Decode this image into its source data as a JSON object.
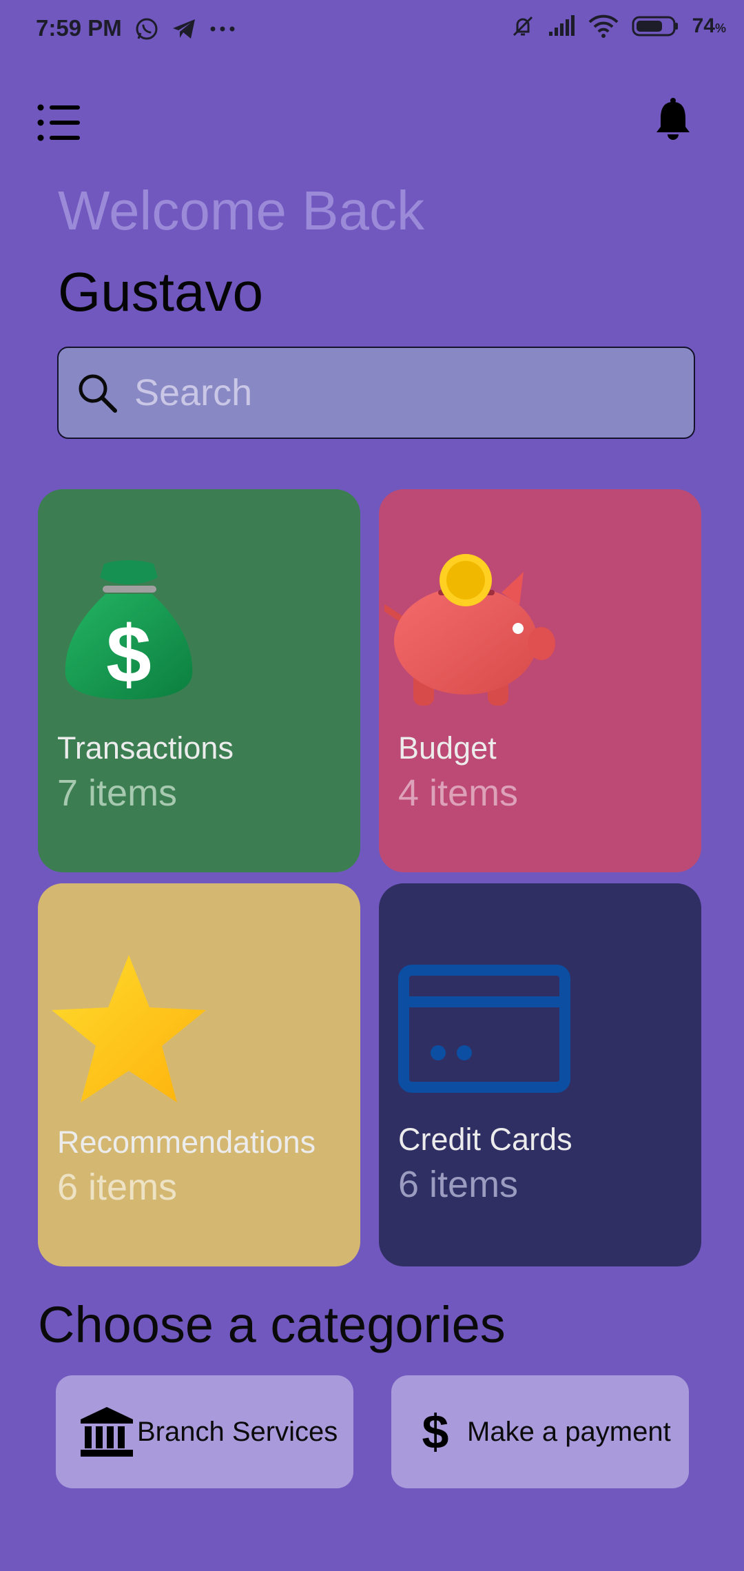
{
  "status_bar": {
    "time": "7:59 PM",
    "left_icons": [
      "whatsapp-icon",
      "telegram-icon",
      "more-dots-icon"
    ],
    "right_icons": [
      "mute-icon",
      "signal-icon",
      "wifi-icon",
      "battery-icon"
    ],
    "battery_percent": "74",
    "battery_unit": "%",
    "battery_level": 0.74
  },
  "header": {
    "menu_icon": "list-menu-icon",
    "notification_icon": "bell-icon"
  },
  "greeting": {
    "welcome": "Welcome Back",
    "user_name": "Gustavo"
  },
  "search": {
    "placeholder": "Search",
    "value": ""
  },
  "cards": [
    {
      "title": "Transactions",
      "count": "7 items",
      "icon": "money-bag-icon",
      "color": "#3C7D52"
    },
    {
      "title": "Budget",
      "count": "4 items",
      "icon": "piggy-bank-icon",
      "color": "#BC4A74"
    },
    {
      "title": "Recommendations",
      "count": "6 items",
      "icon": "star-icon",
      "color": "#D4B872"
    },
    {
      "title": "Credit Cards",
      "count": "6 items",
      "icon": "credit-card-icon",
      "color": "#302F64"
    }
  ],
  "categories": {
    "title": "Choose a categories",
    "items": [
      {
        "label": "Branch Services",
        "icon": "bank-icon"
      },
      {
        "label": "Make a payment",
        "icon": "dollar-icon"
      }
    ]
  },
  "colors": {
    "background": "#7158BF",
    "search_bg": "#8888C4",
    "pill_bg": "#A99ADB",
    "welcome_text": "#9B8AD8"
  }
}
